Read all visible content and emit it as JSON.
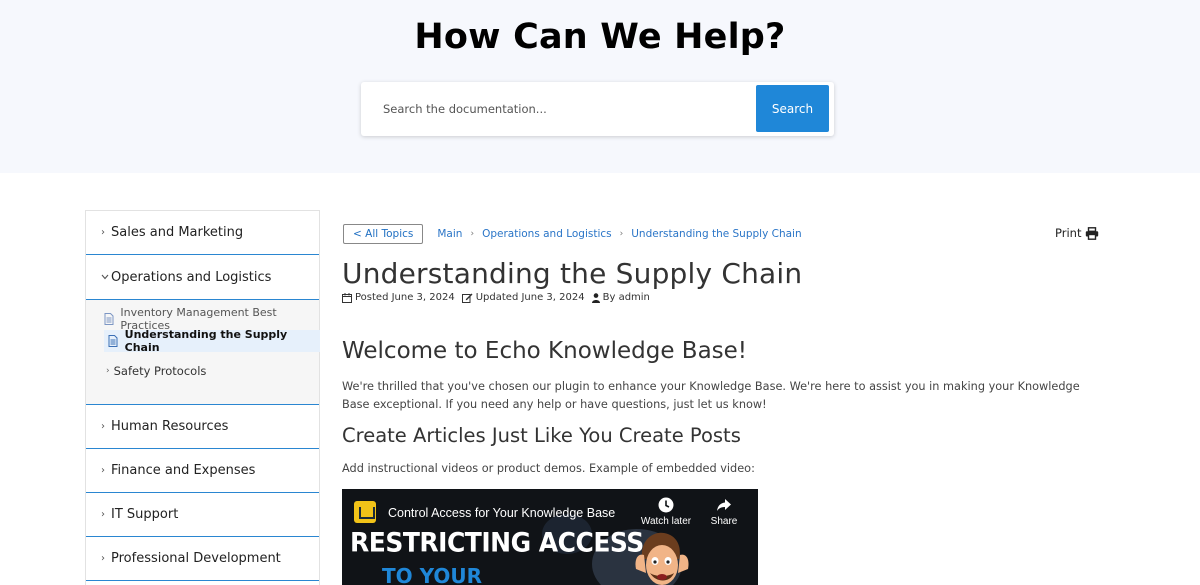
{
  "hero": {
    "title": "How Can We Help?",
    "search_placeholder": "Search the documentation...",
    "search_button": "Search"
  },
  "sidebar": {
    "categories": [
      {
        "label": "Sales and Marketing",
        "expanded": false
      },
      {
        "label": "Operations and Logistics",
        "expanded": true,
        "articles": [
          {
            "label": "Inventory Management Best Practices",
            "active": false
          },
          {
            "label": "Understanding the Supply Chain",
            "active": true
          }
        ],
        "subcategories": [
          {
            "label": "Safety Protocols"
          }
        ]
      },
      {
        "label": "Human Resources",
        "expanded": false
      },
      {
        "label": "Finance and Expenses",
        "expanded": false
      },
      {
        "label": "IT Support",
        "expanded": false
      },
      {
        "label": "Professional Development",
        "expanded": false
      }
    ]
  },
  "breadcrumb": {
    "all_topics": "< All Topics",
    "items": [
      "Main",
      "Operations and Logistics",
      "Understanding the Supply Chain"
    ]
  },
  "print_label": "Print",
  "article": {
    "title": "Understanding the Supply Chain",
    "meta": {
      "posted": "Posted June 3, 2024",
      "updated": "Updated June 3, 2024",
      "author": "By admin"
    },
    "heading1": "Welcome to Echo Knowledge Base!",
    "paragraph1": "We're thrilled that you've chosen our plugin to enhance your Knowledge Base. We're here to assist you in making your Knowledge Base exceptional. If you need any help or have questions, just let us know!",
    "heading2": "Create Articles Just Like You Create Posts",
    "paragraph2": "Add instructional videos or product demos. Example of embedded video:"
  },
  "video": {
    "title": "Control Access for Your Knowledge Base",
    "watch_later": "Watch later",
    "share": "Share",
    "banner_line1": "RESTRICTING ACCESS",
    "banner_line2": "TO YOUR"
  },
  "colors": {
    "accent": "#1f87d8",
    "hero_bg": "#f6f8fd",
    "link": "#2a75c7"
  }
}
